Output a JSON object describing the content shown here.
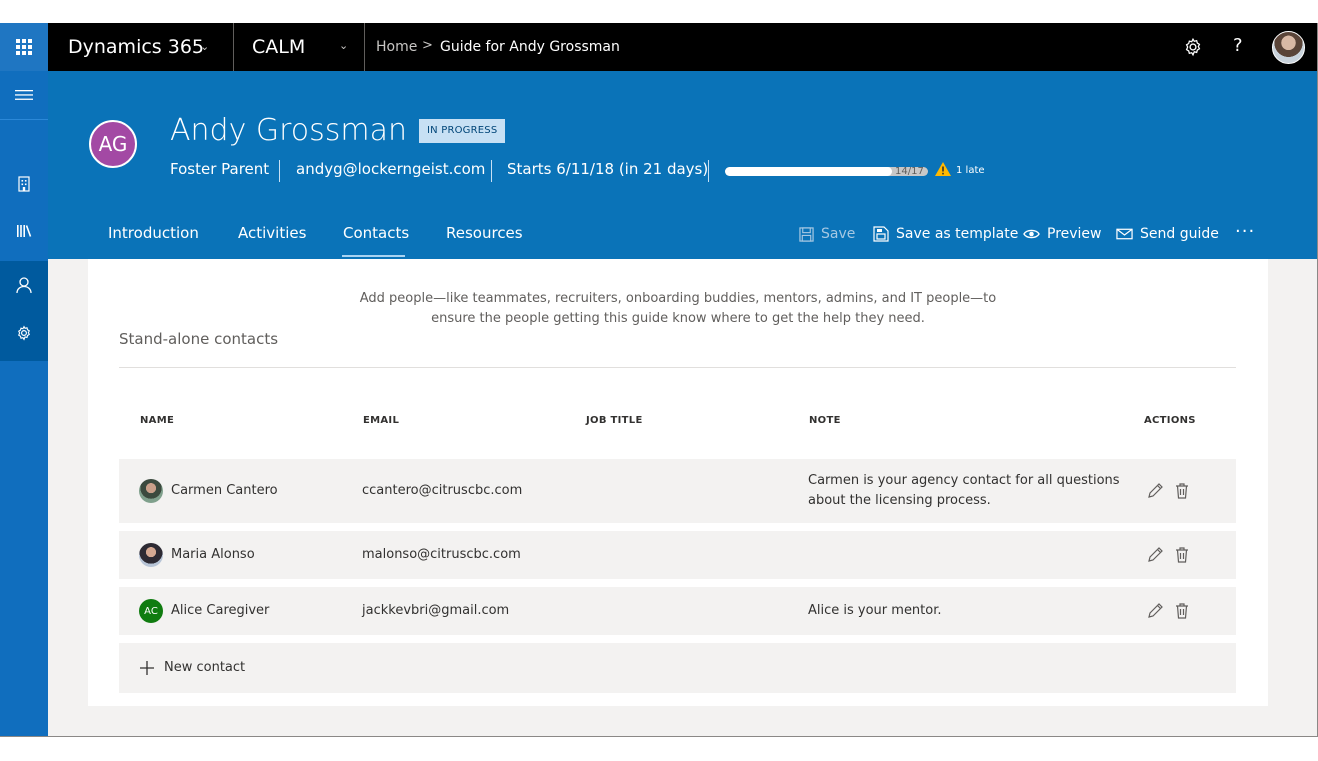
{
  "topbar": {
    "app_name": "Dynamics 365",
    "module_name": "CALM",
    "breadcrumb": {
      "home": "Home",
      "separator": ">",
      "current": "Guide for Andy Grossman"
    },
    "help_label": "?"
  },
  "header": {
    "initials": "AG",
    "name": "Andy Grossman",
    "status": "IN PROGRESS",
    "role": "Foster Parent",
    "email": "andyg@lockerngeist.com",
    "start": "Starts 6/11/18 (in 21 days)",
    "progress": {
      "completed": 14,
      "total": 17,
      "label": "14/17"
    },
    "late_label": "1 late",
    "tabs": [
      "Introduction",
      "Activities",
      "Contacts",
      "Resources"
    ],
    "active_tab": "Contacts",
    "commands": {
      "save": "Save",
      "save_template": "Save as template",
      "preview": "Preview",
      "send": "Send guide"
    },
    "more": "···"
  },
  "content": {
    "intro_line1": "Add people—like teammates, recruiters, onboarding buddies, mentors, admins, and IT people—to",
    "intro_line2": "ensure the people getting this guide know where to get the help they need.",
    "section_title": "Stand-alone contacts",
    "columns": {
      "name": "NAME",
      "email": "EMAIL",
      "job_title": "JOB TITLE",
      "note": "NOTE",
      "actions": "ACTIONS"
    },
    "contacts": [
      {
        "name": "Carmen Cantero",
        "email": "ccantero@citruscbc.com",
        "job_title": "",
        "note_line1": "Carmen is your agency contact for all questions",
        "note_line2": "about the licensing process."
      },
      {
        "name": "Maria Alonso",
        "email": "malonso@citruscbc.com",
        "job_title": "",
        "note_line1": "",
        "note_line2": ""
      },
      {
        "name": "Alice Caregiver",
        "initials": "AC",
        "email": "jackkevbri@gmail.com",
        "job_title": "",
        "note_line1": "Alice is your mentor.",
        "note_line2": ""
      }
    ],
    "new_contact": "New contact"
  },
  "colors": {
    "header_blue": "#0a73b8",
    "rail_blue": "#106ebe",
    "topbar": "#000000",
    "badge_bg": "#c7e0f4",
    "avatar_ag": "#a349a4",
    "avatar_ac": "#107c10",
    "warning": "#ffb900"
  }
}
